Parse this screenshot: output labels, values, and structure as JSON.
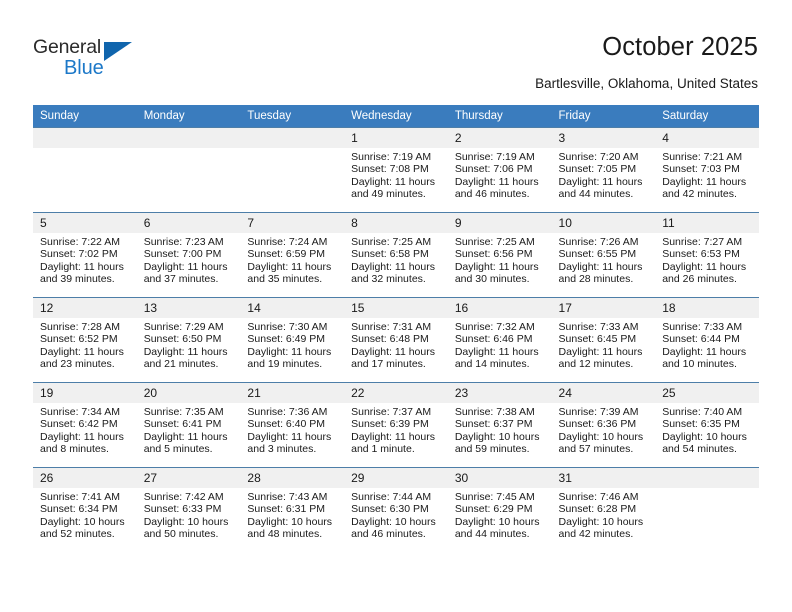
{
  "brand": {
    "name_part1": "General",
    "name_part2": "Blue",
    "triangle_icon": "triangle-icon",
    "accent_color": "#1c78c8",
    "triangle_color": "#1065ad"
  },
  "header": {
    "title": "October 2025",
    "subtitle": "Bartlesville, Oklahoma, United States"
  },
  "calendar": {
    "header_bg": "#3a7cbe",
    "daynum_bg": "#f0f0f0",
    "weekdays": [
      "Sunday",
      "Monday",
      "Tuesday",
      "Wednesday",
      "Thursday",
      "Friday",
      "Saturday"
    ],
    "weeks": [
      [
        {
          "day": "",
          "lines": []
        },
        {
          "day": "",
          "lines": []
        },
        {
          "day": "",
          "lines": []
        },
        {
          "day": "1",
          "lines": [
            "Sunrise: 7:19 AM",
            "Sunset: 7:08 PM",
            "Daylight: 11 hours",
            "and 49 minutes."
          ]
        },
        {
          "day": "2",
          "lines": [
            "Sunrise: 7:19 AM",
            "Sunset: 7:06 PM",
            "Daylight: 11 hours",
            "and 46 minutes."
          ]
        },
        {
          "day": "3",
          "lines": [
            "Sunrise: 7:20 AM",
            "Sunset: 7:05 PM",
            "Daylight: 11 hours",
            "and 44 minutes."
          ]
        },
        {
          "day": "4",
          "lines": [
            "Sunrise: 7:21 AM",
            "Sunset: 7:03 PM",
            "Daylight: 11 hours",
            "and 42 minutes."
          ]
        }
      ],
      [
        {
          "day": "5",
          "lines": [
            "Sunrise: 7:22 AM",
            "Sunset: 7:02 PM",
            "Daylight: 11 hours",
            "and 39 minutes."
          ]
        },
        {
          "day": "6",
          "lines": [
            "Sunrise: 7:23 AM",
            "Sunset: 7:00 PM",
            "Daylight: 11 hours",
            "and 37 minutes."
          ]
        },
        {
          "day": "7",
          "lines": [
            "Sunrise: 7:24 AM",
            "Sunset: 6:59 PM",
            "Daylight: 11 hours",
            "and 35 minutes."
          ]
        },
        {
          "day": "8",
          "lines": [
            "Sunrise: 7:25 AM",
            "Sunset: 6:58 PM",
            "Daylight: 11 hours",
            "and 32 minutes."
          ]
        },
        {
          "day": "9",
          "lines": [
            "Sunrise: 7:25 AM",
            "Sunset: 6:56 PM",
            "Daylight: 11 hours",
            "and 30 minutes."
          ]
        },
        {
          "day": "10",
          "lines": [
            "Sunrise: 7:26 AM",
            "Sunset: 6:55 PM",
            "Daylight: 11 hours",
            "and 28 minutes."
          ]
        },
        {
          "day": "11",
          "lines": [
            "Sunrise: 7:27 AM",
            "Sunset: 6:53 PM",
            "Daylight: 11 hours",
            "and 26 minutes."
          ]
        }
      ],
      [
        {
          "day": "12",
          "lines": [
            "Sunrise: 7:28 AM",
            "Sunset: 6:52 PM",
            "Daylight: 11 hours",
            "and 23 minutes."
          ]
        },
        {
          "day": "13",
          "lines": [
            "Sunrise: 7:29 AM",
            "Sunset: 6:50 PM",
            "Daylight: 11 hours",
            "and 21 minutes."
          ]
        },
        {
          "day": "14",
          "lines": [
            "Sunrise: 7:30 AM",
            "Sunset: 6:49 PM",
            "Daylight: 11 hours",
            "and 19 minutes."
          ]
        },
        {
          "day": "15",
          "lines": [
            "Sunrise: 7:31 AM",
            "Sunset: 6:48 PM",
            "Daylight: 11 hours",
            "and 17 minutes."
          ]
        },
        {
          "day": "16",
          "lines": [
            "Sunrise: 7:32 AM",
            "Sunset: 6:46 PM",
            "Daylight: 11 hours",
            "and 14 minutes."
          ]
        },
        {
          "day": "17",
          "lines": [
            "Sunrise: 7:33 AM",
            "Sunset: 6:45 PM",
            "Daylight: 11 hours",
            "and 12 minutes."
          ]
        },
        {
          "day": "18",
          "lines": [
            "Sunrise: 7:33 AM",
            "Sunset: 6:44 PM",
            "Daylight: 11 hours",
            "and 10 minutes."
          ]
        }
      ],
      [
        {
          "day": "19",
          "lines": [
            "Sunrise: 7:34 AM",
            "Sunset: 6:42 PM",
            "Daylight: 11 hours",
            "and 8 minutes."
          ]
        },
        {
          "day": "20",
          "lines": [
            "Sunrise: 7:35 AM",
            "Sunset: 6:41 PM",
            "Daylight: 11 hours",
            "and 5 minutes."
          ]
        },
        {
          "day": "21",
          "lines": [
            "Sunrise: 7:36 AM",
            "Sunset: 6:40 PM",
            "Daylight: 11 hours",
            "and 3 minutes."
          ]
        },
        {
          "day": "22",
          "lines": [
            "Sunrise: 7:37 AM",
            "Sunset: 6:39 PM",
            "Daylight: 11 hours",
            "and 1 minute."
          ]
        },
        {
          "day": "23",
          "lines": [
            "Sunrise: 7:38 AM",
            "Sunset: 6:37 PM",
            "Daylight: 10 hours",
            "and 59 minutes."
          ]
        },
        {
          "day": "24",
          "lines": [
            "Sunrise: 7:39 AM",
            "Sunset: 6:36 PM",
            "Daylight: 10 hours",
            "and 57 minutes."
          ]
        },
        {
          "day": "25",
          "lines": [
            "Sunrise: 7:40 AM",
            "Sunset: 6:35 PM",
            "Daylight: 10 hours",
            "and 54 minutes."
          ]
        }
      ],
      [
        {
          "day": "26",
          "lines": [
            "Sunrise: 7:41 AM",
            "Sunset: 6:34 PM",
            "Daylight: 10 hours",
            "and 52 minutes."
          ]
        },
        {
          "day": "27",
          "lines": [
            "Sunrise: 7:42 AM",
            "Sunset: 6:33 PM",
            "Daylight: 10 hours",
            "and 50 minutes."
          ]
        },
        {
          "day": "28",
          "lines": [
            "Sunrise: 7:43 AM",
            "Sunset: 6:31 PM",
            "Daylight: 10 hours",
            "and 48 minutes."
          ]
        },
        {
          "day": "29",
          "lines": [
            "Sunrise: 7:44 AM",
            "Sunset: 6:30 PM",
            "Daylight: 10 hours",
            "and 46 minutes."
          ]
        },
        {
          "day": "30",
          "lines": [
            "Sunrise: 7:45 AM",
            "Sunset: 6:29 PM",
            "Daylight: 10 hours",
            "and 44 minutes."
          ]
        },
        {
          "day": "31",
          "lines": [
            "Sunrise: 7:46 AM",
            "Sunset: 6:28 PM",
            "Daylight: 10 hours",
            "and 42 minutes."
          ]
        },
        {
          "day": "",
          "lines": []
        }
      ]
    ]
  }
}
